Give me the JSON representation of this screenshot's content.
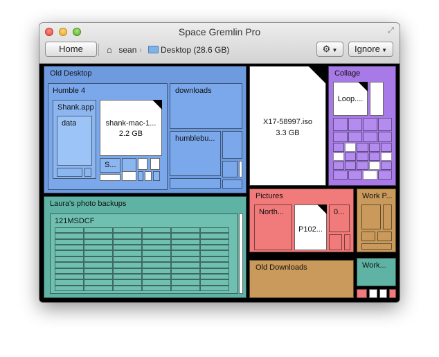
{
  "window": {
    "title": "Space Gremlin Pro"
  },
  "toolbar": {
    "home_label": "Home",
    "ignore_label": "Ignore",
    "breadcrumb": [
      {
        "label": "sean",
        "icon": "home-icon"
      },
      {
        "label": "Desktop (28.6 GB)",
        "icon": "folder-icon"
      }
    ]
  },
  "treemap": {
    "old_desktop": {
      "label": "Old Desktop",
      "humble4": {
        "label": "Humble 4",
        "shank_app": {
          "label": "Shank.app",
          "data": "data"
        },
        "shank_mac": {
          "name": "shank-mac-1...",
          "size": "2.2 GB"
        },
        "s_file": "S..."
      },
      "downloads": "downloads",
      "humblebundle": "humblebu..."
    },
    "iso": {
      "name": "X17-58997.iso",
      "size": "3.3 GB"
    },
    "collage": {
      "label": "Collage",
      "loop": "Loop...."
    },
    "laura": {
      "label": "Laura's photo backups",
      "folder": "121MSDCF"
    },
    "pictures": {
      "label": "Pictures",
      "north": "North...",
      "p102": "P102...",
      "zero": "0..."
    },
    "work_p": "Work P...",
    "old_downloads": "Old Downloads",
    "work2": "Work..."
  },
  "colors": {
    "blue": "#6e9be0",
    "teal": "#5fb3a4",
    "purple": "#a77ae8",
    "pink": "#f17a7a",
    "tan": "#c99a5b"
  }
}
